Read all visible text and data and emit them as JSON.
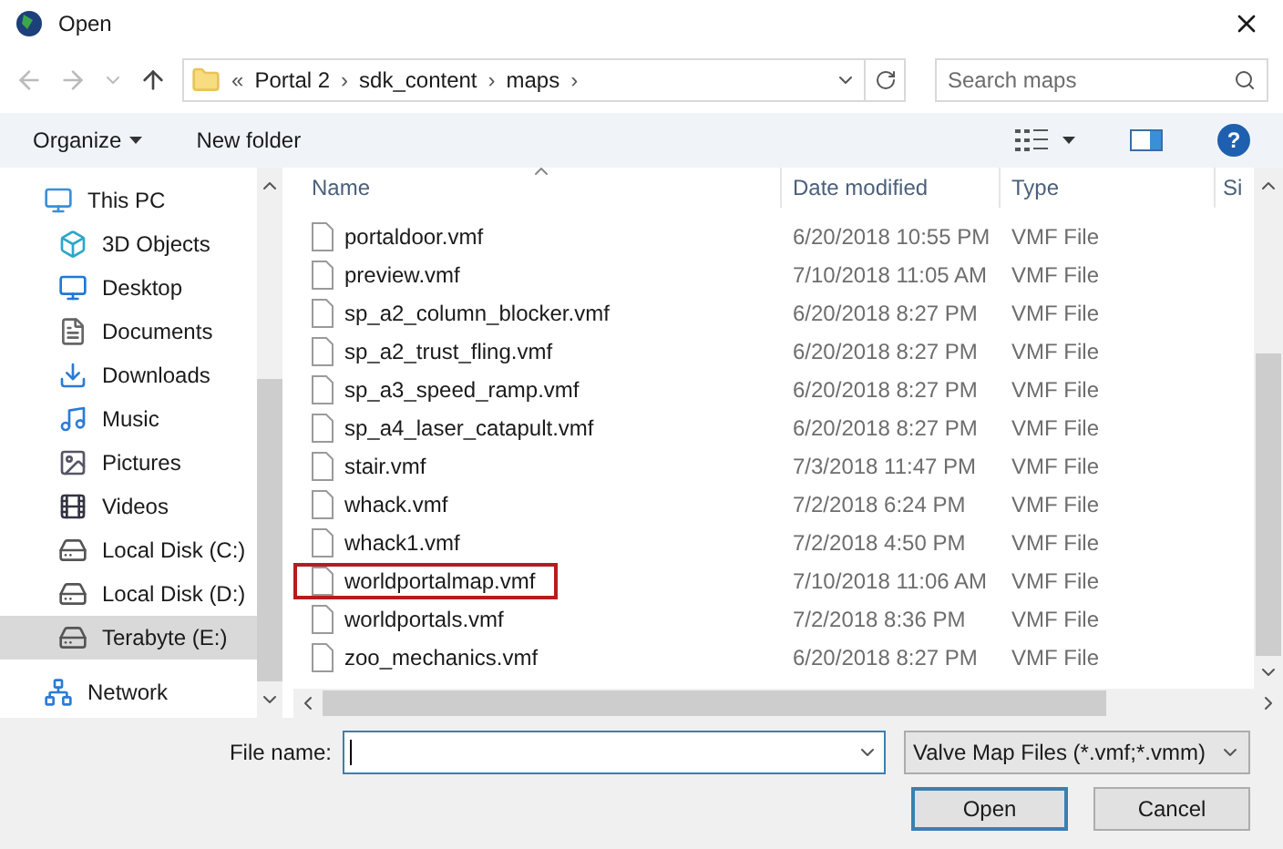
{
  "window": {
    "title": "Open"
  },
  "address": {
    "prefix": "«",
    "parts": [
      "Portal 2",
      "sdk_content",
      "maps"
    ],
    "separator": "›"
  },
  "search": {
    "placeholder": "Search maps"
  },
  "toolbar": {
    "organize": "Organize",
    "new_folder": "New folder",
    "help": "?"
  },
  "sidebar": {
    "items": [
      {
        "label": "This PC",
        "kind": "pc",
        "selected": false,
        "children": [
          {
            "label": "3D Objects",
            "kind": "cube",
            "selected": false
          },
          {
            "label": "Desktop",
            "kind": "desktop",
            "selected": false
          },
          {
            "label": "Documents",
            "kind": "documents",
            "selected": false
          },
          {
            "label": "Downloads",
            "kind": "downloads",
            "selected": false
          },
          {
            "label": "Music",
            "kind": "music",
            "selected": false
          },
          {
            "label": "Pictures",
            "kind": "pictures",
            "selected": false
          },
          {
            "label": "Videos",
            "kind": "videos",
            "selected": false
          },
          {
            "label": "Local Disk (C:)",
            "kind": "disk",
            "selected": false
          },
          {
            "label": "Local Disk (D:)",
            "kind": "disk",
            "selected": false
          },
          {
            "label": "Terabyte (E:)",
            "kind": "disk",
            "selected": true
          }
        ]
      },
      {
        "label": "Network",
        "kind": "network",
        "selected": false
      }
    ]
  },
  "table": {
    "columns": [
      "Name",
      "Date modified",
      "Type",
      "Si"
    ],
    "rows": [
      {
        "name": "portaldoor.vmf",
        "date": "6/20/2018 10:55 PM",
        "type": "VMF File",
        "highlighted": false
      },
      {
        "name": "preview.vmf",
        "date": "7/10/2018 11:05 AM",
        "type": "VMF File",
        "highlighted": false
      },
      {
        "name": "sp_a2_column_blocker.vmf",
        "date": "6/20/2018 8:27 PM",
        "type": "VMF File",
        "highlighted": false
      },
      {
        "name": "sp_a2_trust_fling.vmf",
        "date": "6/20/2018 8:27 PM",
        "type": "VMF File",
        "highlighted": false
      },
      {
        "name": "sp_a3_speed_ramp.vmf",
        "date": "6/20/2018 8:27 PM",
        "type": "VMF File",
        "highlighted": false
      },
      {
        "name": "sp_a4_laser_catapult.vmf",
        "date": "6/20/2018 8:27 PM",
        "type": "VMF File",
        "highlighted": false
      },
      {
        "name": "stair.vmf",
        "date": "7/3/2018 11:47 PM",
        "type": "VMF File",
        "highlighted": false
      },
      {
        "name": "whack.vmf",
        "date": "7/2/2018 6:24 PM",
        "type": "VMF File",
        "highlighted": false
      },
      {
        "name": "whack1.vmf",
        "date": "7/2/2018 4:50 PM",
        "type": "VMF File",
        "highlighted": false
      },
      {
        "name": "worldportalmap.vmf",
        "date": "7/10/2018 11:06 AM",
        "type": "VMF File",
        "highlighted": true
      },
      {
        "name": "worldportals.vmf",
        "date": "7/2/2018 8:36 PM",
        "type": "VMF File",
        "highlighted": false
      },
      {
        "name": "zoo_mechanics.vmf",
        "date": "6/20/2018 8:27 PM",
        "type": "VMF File",
        "highlighted": false
      }
    ]
  },
  "footer": {
    "file_name_label": "File name:",
    "file_type": "Valve Map Files (*.vmf;*.vmm)",
    "open": "Open",
    "cancel": "Cancel"
  }
}
